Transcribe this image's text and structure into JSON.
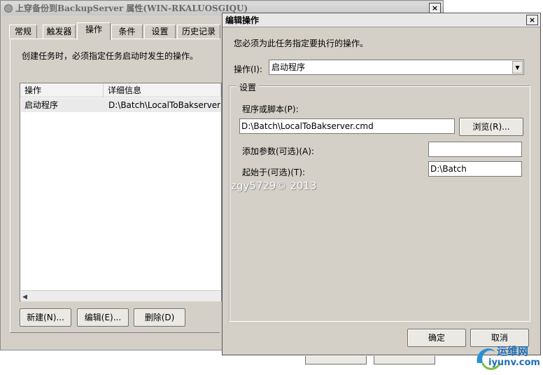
{
  "background_window": {
    "title": "上穿备份到BackupServer 属性(WIN-RKALUOSGIQU)",
    "close": "×",
    "tabs": [
      "常规",
      "触发器",
      "操作",
      "条件",
      "设置",
      "历史记录"
    ],
    "description": "创建任务时，必须指定任务启动时发生的操作。",
    "columns": [
      "操作",
      "详细信息"
    ],
    "rows": [
      {
        "action": "启动程序",
        "details": "D:\\Batch\\LocalToBakserver.c"
      }
    ],
    "buttons": {
      "new": "新建(N)...",
      "edit": "编辑(E)...",
      "delete": "删除(D)"
    }
  },
  "dialog": {
    "title": "编辑操作",
    "close": "×",
    "description": "您必须为此任务指定要执行的操作。",
    "action_label": "操作(I):",
    "action_value": "启动程序",
    "settings_label": "设置",
    "program_label": "程序或脚本(P):",
    "program_value": "D:\\Batch\\LocalToBakserver.cmd",
    "browse": "浏览(R)...",
    "args_label": "添加参数(可选)(A):",
    "args_value": "",
    "start_in_label": "起始于(可选)(T):",
    "start_in_value": "D:\\Batch",
    "ok": "确定",
    "cancel": "取消"
  },
  "watermark": "zgy5729© 2013",
  "logo": {
    "cn": "运维网",
    "url": "iyunv.com"
  }
}
